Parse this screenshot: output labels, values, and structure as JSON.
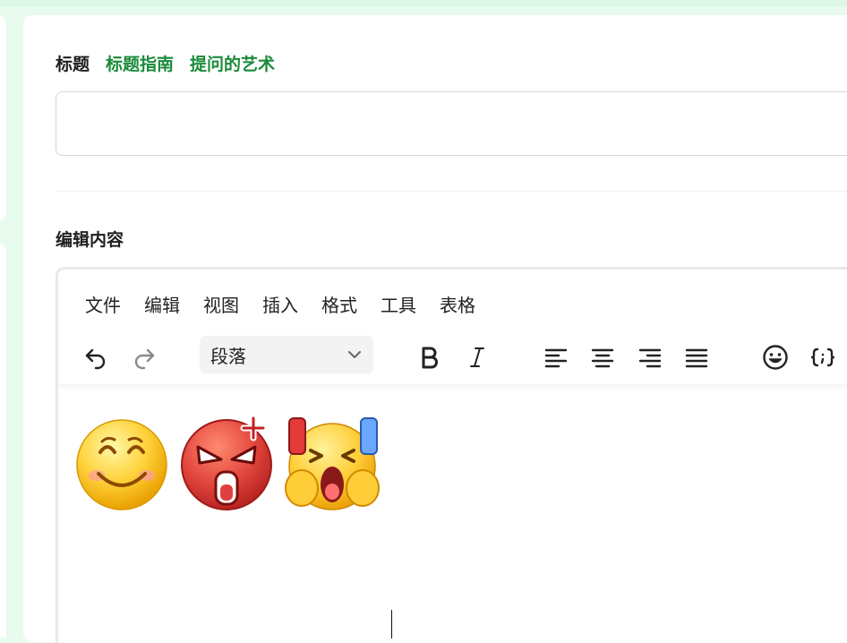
{
  "form": {
    "title_label": "标题",
    "title_links": [
      "标题指南",
      "提问的艺术"
    ],
    "title_input_value": "",
    "content_label": "编辑内容"
  },
  "editor": {
    "menu": [
      "文件",
      "编辑",
      "视图",
      "插入",
      "格式",
      "工具",
      "表格"
    ],
    "block_format": "段落",
    "toolbar_icons": [
      "undo-icon",
      "redo-icon",
      "bold-icon",
      "italic-icon",
      "align-left-icon",
      "align-center-icon",
      "align-right-icon",
      "align-justify-icon",
      "emoji-icon",
      "code-icon"
    ],
    "content_emojis": [
      "smile-emoji",
      "angry-emoji",
      "cheering-emoji"
    ]
  },
  "colors": {
    "accent": "#1a8a3a",
    "background": "#e8fbee"
  }
}
